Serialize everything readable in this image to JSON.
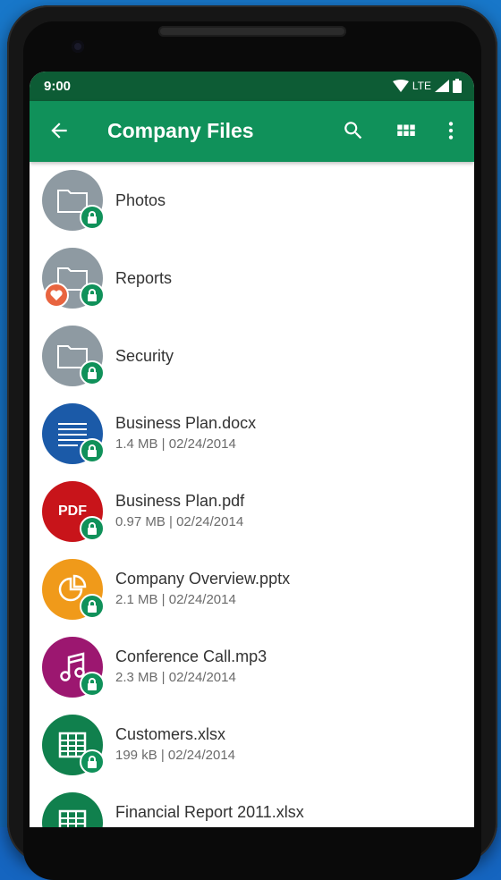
{
  "status_bar": {
    "time": "9:00",
    "network": "LTE"
  },
  "appbar": {
    "title": "Company Files",
    "icons": [
      "back-arrow-icon",
      "search-icon",
      "grid-view-icon",
      "more-vert-icon"
    ]
  },
  "colors": {
    "status_bar": "#0d5c35",
    "appbar": "#10915a",
    "folder": "#8e9aa2",
    "docx": "#1b5aa8",
    "pdf": "#c8141a",
    "pptx": "#f09a1a",
    "mp3": "#9c1770",
    "xlsx": "#10804d",
    "lock_badge": "#10915a",
    "favorite_badge": "#e8643f"
  },
  "files": [
    {
      "name": "Photos",
      "type": "folder",
      "icon": "folder-icon",
      "locked": true,
      "favorite": false,
      "meta": ""
    },
    {
      "name": "Reports",
      "type": "folder",
      "icon": "folder-icon",
      "locked": true,
      "favorite": true,
      "meta": ""
    },
    {
      "name": "Security",
      "type": "folder",
      "icon": "folder-icon",
      "locked": true,
      "favorite": false,
      "meta": ""
    },
    {
      "name": "Business Plan.docx",
      "type": "docx",
      "icon": "document-icon",
      "locked": true,
      "favorite": false,
      "meta": "1.4 MB | 02/24/2014"
    },
    {
      "name": "Business Plan.pdf",
      "type": "pdf",
      "icon": "pdf-icon",
      "locked": true,
      "favorite": false,
      "meta": "0.97 MB | 02/24/2014",
      "icon_text": "PDF"
    },
    {
      "name": "Company Overview.pptx",
      "type": "pptx",
      "icon": "pie-chart-icon",
      "locked": true,
      "favorite": false,
      "meta": "2.1 MB | 02/24/2014"
    },
    {
      "name": "Conference Call.mp3",
      "type": "mp3",
      "icon": "music-note-icon",
      "locked": true,
      "favorite": false,
      "meta": "2.3 MB | 02/24/2014"
    },
    {
      "name": "Customers.xlsx",
      "type": "xlsx",
      "icon": "spreadsheet-icon",
      "locked": true,
      "favorite": false,
      "meta": "199 kB | 02/24/2014"
    },
    {
      "name": "Financial Report 2011.xlsx",
      "type": "xlsx",
      "icon": "spreadsheet-icon",
      "locked": false,
      "favorite": false,
      "meta": ""
    }
  ]
}
